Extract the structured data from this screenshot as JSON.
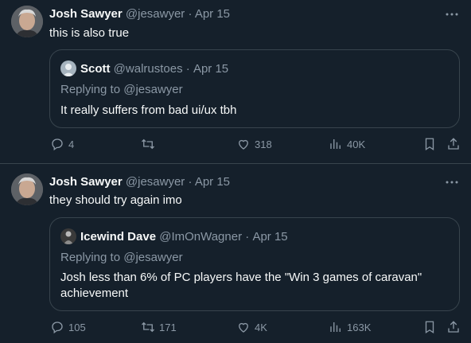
{
  "tweets": [
    {
      "author_name": "Josh Sawyer",
      "handle": "@jesawyer",
      "separator": "·",
      "date": "Apr 15",
      "text": "this is also true",
      "quote": {
        "author_name": "Scott",
        "handle": "@walrustoes",
        "separator": "·",
        "date": "Apr 15",
        "replying_to": "Replying to @jesawyer",
        "text": "It really suffers from bad ui/ux tbh"
      },
      "actions": {
        "replies": "4",
        "retweets": "",
        "likes": "318",
        "views": "40K"
      }
    },
    {
      "author_name": "Josh Sawyer",
      "handle": "@jesawyer",
      "separator": "·",
      "date": "Apr 15",
      "text": "they should try again imo",
      "quote": {
        "author_name": "Icewind Dave",
        "handle": "@ImOnWagner",
        "separator": "·",
        "date": "Apr 15",
        "replying_to": "Replying to @jesawyer",
        "text": "Josh less than 6% of PC players have the \"Win 3 games of caravan\" achievement"
      },
      "actions": {
        "replies": "105",
        "retweets": "171",
        "likes": "4K",
        "views": "163K"
      }
    }
  ],
  "colors": {
    "background": "#15202b",
    "text": "#f7f9f9",
    "secondary": "#8b98a5",
    "border": "#38444d"
  },
  "icons": [
    "reply-icon",
    "retweet-icon",
    "like-icon",
    "views-icon",
    "bookmark-icon",
    "share-icon",
    "more-icon"
  ]
}
